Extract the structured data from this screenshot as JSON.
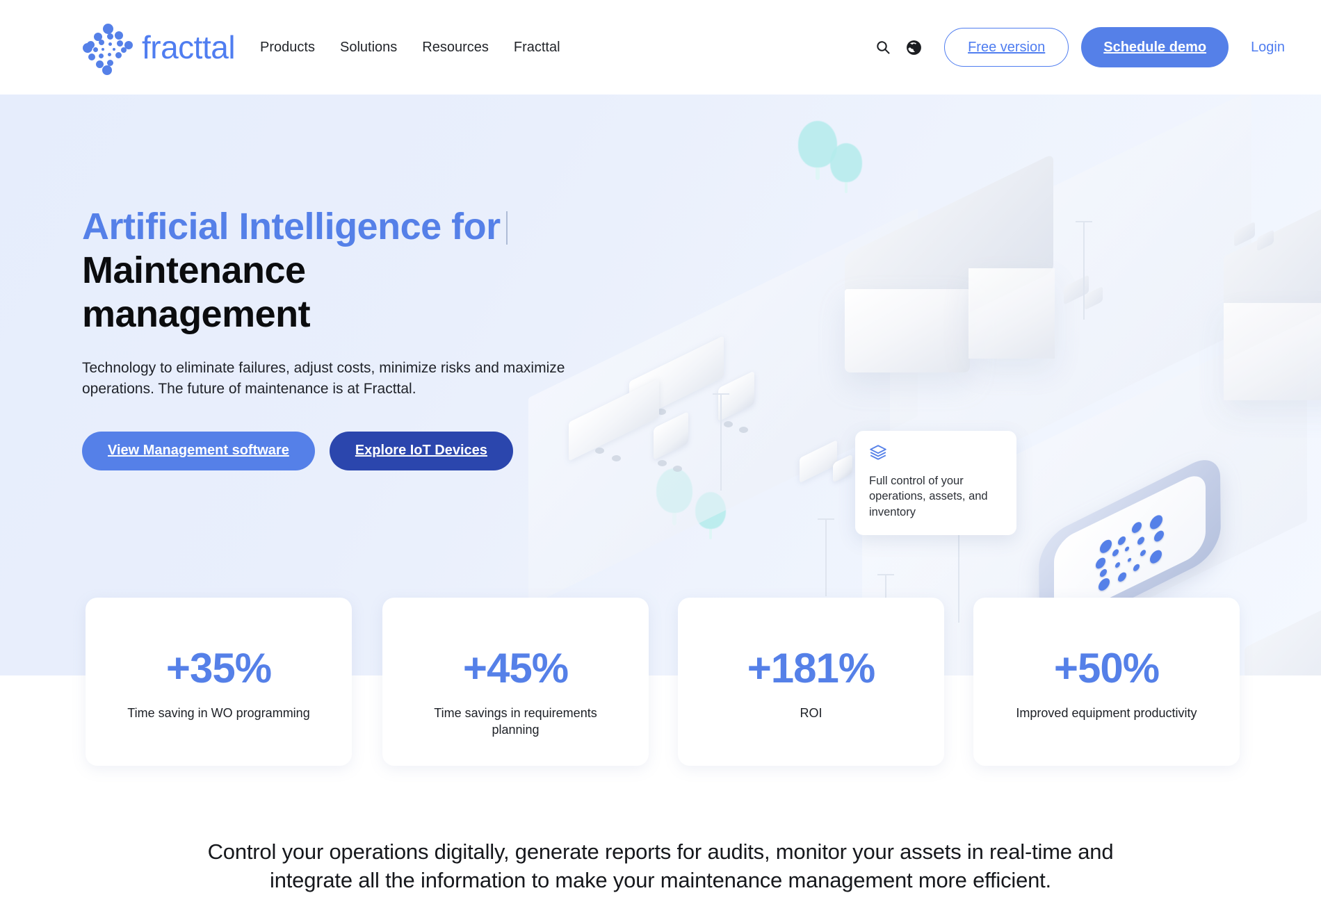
{
  "header": {
    "logo_word": "fracttal",
    "logo_icon": "fracttal-dots-logo",
    "nav": [
      {
        "label": "Products"
      },
      {
        "label": "Solutions"
      },
      {
        "label": "Resources"
      },
      {
        "label": "Fracttal"
      }
    ],
    "search_icon": "search-icon",
    "language_icon": "globe-icon",
    "free_version_label": "Free version",
    "schedule_demo_label": "Schedule demo",
    "login_label": "Login"
  },
  "hero": {
    "headline_accent": "Artificial Intelligence for",
    "headline_line2": "Maintenance",
    "headline_line3": "management",
    "subtext": "Technology to eliminate failures, adjust costs, minimize risks and maximize operations. The future of maintenance is at Fracttal.",
    "cta_primary": "View Management software",
    "cta_secondary": "Explore IoT Devices",
    "float_card": {
      "icon": "layers-icon",
      "text": "Full control of your operations, assets, and inventory"
    }
  },
  "stats": [
    {
      "value": "+35%",
      "label": "Time saving in WO programming"
    },
    {
      "value": "+45%",
      "label": "Time savings in requirements planning"
    },
    {
      "value": "+181%",
      "label": "ROI"
    },
    {
      "value": "+50%",
      "label": "Improved equipment productivity"
    }
  ],
  "blurb": {
    "line1": "Control your operations digitally, generate reports for audits, monitor your assets in real-time and",
    "line2": "integrate all the information to make your maintenance management more efficient."
  },
  "colors": {
    "brand_blue": "#5580e8",
    "link_blue": "#4f7df0",
    "navy": "#2b46ad",
    "hero_bg": "#e8eefc",
    "text_dark": "#16181c"
  }
}
